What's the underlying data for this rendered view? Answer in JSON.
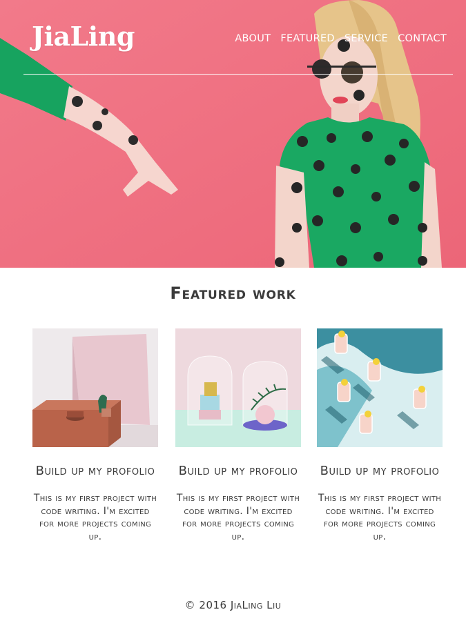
{
  "header": {
    "logo": "JiaLing",
    "nav": [
      "About",
      "Featured",
      "Service",
      "Contact"
    ]
  },
  "hero": {
    "image": "fashion-model-polka-dot-dress",
    "background_color": "#f07181"
  },
  "featured": {
    "title": "Featured work",
    "cards": [
      {
        "image": "pink-terracotta-still-life",
        "title": "Build up my profolio",
        "text": "This is my first project with code writing. I'm excited for more projects coming up."
      },
      {
        "image": "glass-domes-still-life",
        "title": "Build up my profolio",
        "text": "This is my first project with code writing. I'm excited for more projects coming up."
      },
      {
        "image": "citrus-drinks-glasses",
        "title": "Build up my profolio",
        "text": "This is my first project with code writing. I'm excited for more projects coming up."
      }
    ]
  },
  "footer": {
    "copyright": "© 2016 JiaLing Liu"
  }
}
